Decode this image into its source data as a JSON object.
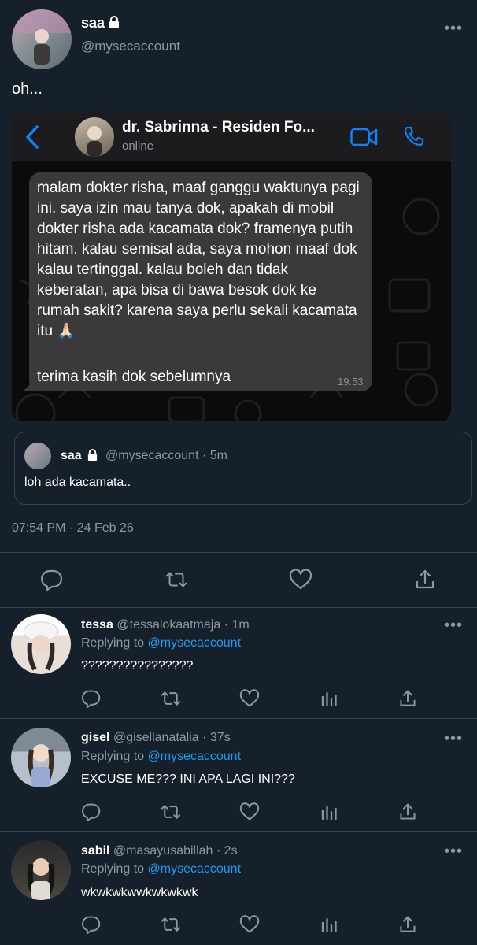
{
  "tweet": {
    "author_name": "saa",
    "author_handle": "@mysecaccount",
    "text": "oh...",
    "timestamp": "07:54 PM · 24 Feb 26"
  },
  "screenshot": {
    "contact_name": "dr. Sabrinna - Residen Fo...",
    "contact_status": "online",
    "message_text": "malam dokter risha, maaf ganggu waktunya pagi ini. saya izin mau tanya dok, apakah di mobil dokter risha ada kacamata dok? framenya putih hitam. kalau semisal ada, saya mohon maaf dok kalau tertinggal. kalau boleh dan tidak keberatan, apa bisa di bawa besok dok ke rumah sakit? karena saya perlu sekali kacamata itu 🙏🏻",
    "message_text_2": "terima kasih dok sebelumnya",
    "message_time": "19.53"
  },
  "quote": {
    "author_name": "saa",
    "meta": "@mysecaccount · 5m",
    "text": "loh ada kacamata.."
  },
  "replies": [
    {
      "name": "tessa",
      "meta": "@tessalokaatmaja · 1m",
      "replying_prefix": "Replying to",
      "replying_to": "@mysecaccount",
      "text": "????????????????"
    },
    {
      "name": "gisel",
      "meta": "@gisellanatalia · 37s",
      "replying_prefix": "Replying to",
      "replying_to": "@mysecaccount",
      "text": "EXCUSE ME??? INI APA LAGI INI???"
    },
    {
      "name": "sabil",
      "meta": "@masayusabillah · 2s",
      "replying_prefix": "Replying to",
      "replying_to": "@mysecaccount",
      "text": "wkwkwkwwkwkwkwk"
    }
  ],
  "colors": {
    "background": "#15202b",
    "accent": "#1d9bf0",
    "muted": "#8b98a5",
    "chat_bubble": "#3a3a3c",
    "chat_background": "#0b0b0b"
  }
}
